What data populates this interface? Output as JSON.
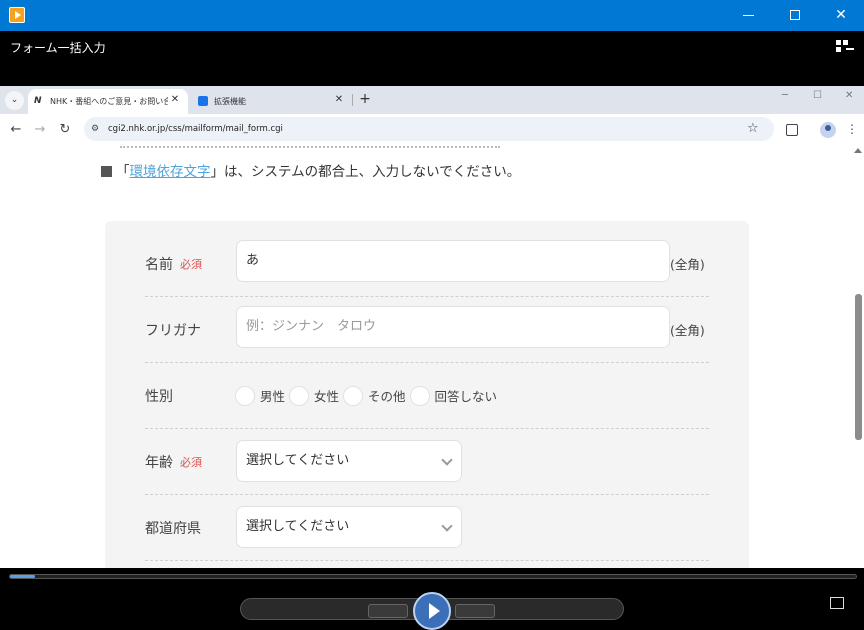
{
  "player": {
    "title": "フォーム一括入力"
  },
  "window_controls": {
    "minimize": "minimize-icon",
    "maximize": "maximize-icon",
    "close": "✕"
  },
  "browser": {
    "tabs": [
      {
        "label": "NHK・番組へのご意見・お問い合わ",
        "favicon": "N",
        "active": true
      },
      {
        "label": "拡張機能",
        "favicon": "puzzle-icon",
        "active": false
      }
    ],
    "url": "cgi2.nhk.or.jp/css/mailform/mail_form.cgi"
  },
  "page": {
    "notice_prefix": "「",
    "notice_link": "環境依存文字",
    "notice_suffix": "」は、システムの都合上、入力しないでください。",
    "form": {
      "name": {
        "label": "名前",
        "required": "必須",
        "value": "あ",
        "suffix": "(全角)"
      },
      "furigana": {
        "label": "フリガナ",
        "placeholder": "例：ジンナン　タロウ",
        "suffix": "(全角)"
      },
      "gender": {
        "label": "性別",
        "options": [
          "男性",
          "女性",
          "その他",
          "回答しない"
        ]
      },
      "age": {
        "label": "年齢",
        "required": "必須",
        "selected": "選択してください"
      },
      "prefecture": {
        "label": "都道府県",
        "selected": "選択してください"
      }
    }
  },
  "controls": {
    "progress": 0.03
  },
  "colors": {
    "titlebar": "#0078d4",
    "required": "#d9534f",
    "link": "#4ea3d8",
    "seek_fill": "#5aa0e8"
  }
}
